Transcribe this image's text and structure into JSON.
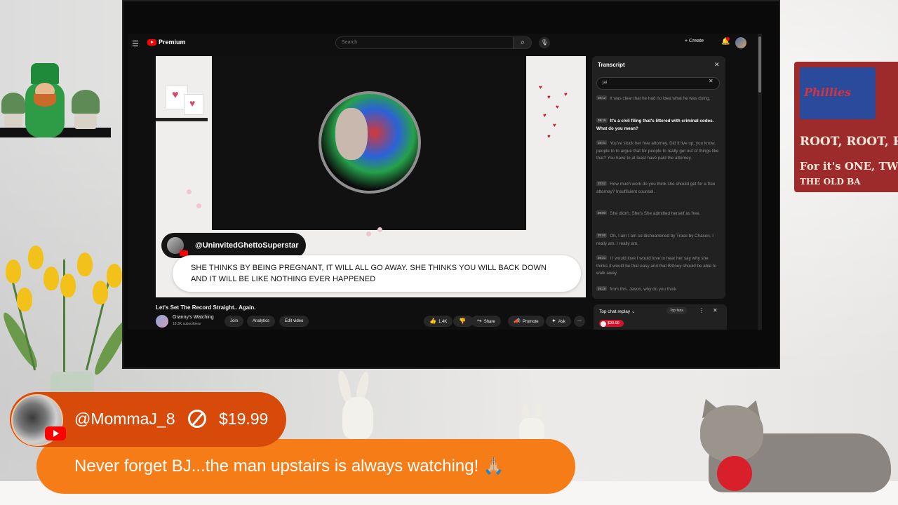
{
  "youtube": {
    "logo_text": "Premium",
    "search_placeholder": "Search",
    "create_label": "Create",
    "video": {
      "overlay_username": "@UninvitedGhettoSuperstar",
      "caption": "SHE THINKS BY BEING PREGNANT, IT WILL ALL GO AWAY. SHE THINKS YOU WILL BACK DOWN AND IT WILL BE LIKE NOTHING EVER HAPPENED",
      "title": "Let's Set The Record Straight.. Again."
    },
    "channel": {
      "name": "Granny's Watching",
      "subscribers": "18.3K subscribers",
      "join_label": "Join",
      "analytics_label": "Analytics",
      "edit_label": "Edit video"
    },
    "actions": {
      "likes": "1.4K",
      "share_label": "Share",
      "promote_label": "Promote",
      "ask_label": "Ask"
    },
    "transcript": {
      "title": "Transcript",
      "search_value": "jai",
      "entries": [
        {
          "time": "38:12",
          "text": "It was clear that he had no idea what he was doing."
        },
        {
          "time": "38:15",
          "text": "It's a civil filing that's littered with criminal codes. What do you mean?"
        },
        {
          "time": "38:41",
          "text": "You're stuck her free attorney. Did it live up, you know, people to to argue that for people to really get out of things like that? You have to at least have paid the attorney."
        },
        {
          "time": "38:52",
          "text": "How much work do you think she should get for a free attorney? Insufficient counsel."
        },
        {
          "time": "39:00",
          "text": "She didn't. She's She admitted herself as free."
        },
        {
          "time": "39:08",
          "text": "Oh, I am I am so disheartened by Trace by Chason. I really am. I really am."
        },
        {
          "time": "39:21",
          "text": "I I would love I would love to hear her say why she thinks it would be that easy and that Britney should be able to walk away."
        },
        {
          "time": "39:29",
          "text": "from this. Jason, why do you think"
        }
      ]
    },
    "chat": {
      "title": "Top chat replay",
      "top_fans_label": "Top fans",
      "donation": "$99.99"
    }
  },
  "sign": {
    "team": "Phillies",
    "line1": "ROOT, ROOT, R",
    "line2": "For it's ONE, TWO, TH",
    "line3": "THE OLD BA"
  },
  "super_chat": {
    "username": "@MommaJ_8",
    "amount": "$19.99",
    "message": "Never forget BJ...the man upstairs is always watching! 🙏🏼",
    "colors": {
      "header": "#d84a0a",
      "body": "#f57c16"
    }
  }
}
